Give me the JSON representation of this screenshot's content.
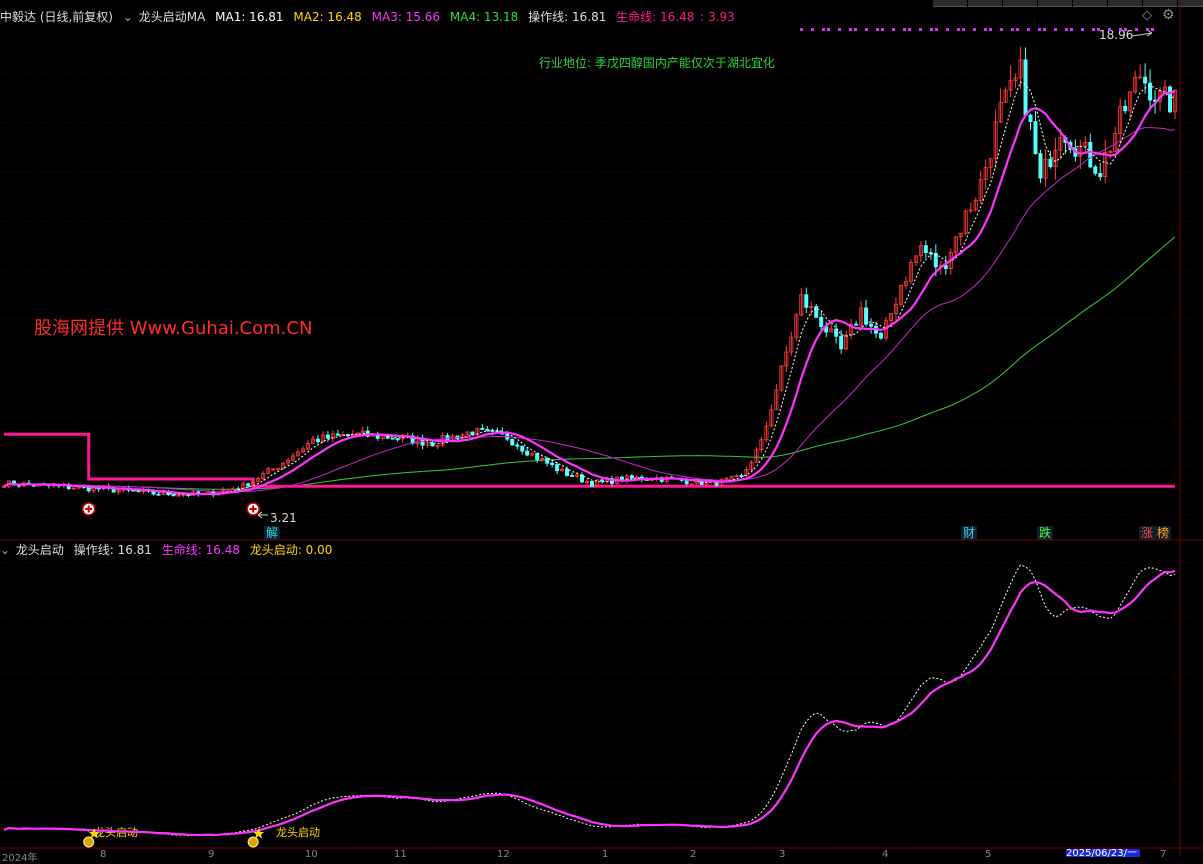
{
  "main_panel": {
    "stock_label": "中毅达 (日线,前复权)",
    "indicator_name": "龙头启动MA",
    "ma1": {
      "label": "MA1: 16.81",
      "color": "#ffffff"
    },
    "ma2": {
      "label": "MA2: 16.48",
      "color": "#ffd700"
    },
    "ma3": {
      "label": "MA3: 15.66",
      "color": "#ff33ff"
    },
    "ma4": {
      "label": "MA4: 13.18",
      "color": "#33dd33"
    },
    "operation_line": "操作线: 16.81",
    "life_line": "生命线: 16.48",
    "ratio": ": 3.93",
    "industry_note": "行业地位: 季戊四醇国内产能仅次于湖北宜化",
    "high_label": "18.96",
    "low_label": "3.21",
    "badges": [
      {
        "text": "解",
        "color": "#22ddee"
      },
      {
        "text": "财",
        "color": "#22ddee"
      },
      {
        "text": "跌",
        "color": "#44ff44"
      },
      {
        "text": "涨",
        "color": "#ff4444"
      },
      {
        "text": "榜",
        "color": "#ffaa00"
      }
    ]
  },
  "watermark": "股海网提供 Www.Guhai.Com.CN",
  "sub_panel": {
    "indicator_name": "龙头启动",
    "operation_line": "操作线: 16.81",
    "life_line": "生命线: 16.48",
    "launch_value": "龙头启动: 0.00",
    "launch_markers": [
      "龙头启动",
      "龙头启动"
    ]
  },
  "date_axis": {
    "labels": [
      "2024年",
      "8",
      "9",
      "10",
      "11",
      "12",
      "1",
      "2",
      "3",
      "4",
      "5",
      "6",
      "7"
    ],
    "current_date": "2025/06/23/一"
  },
  "colors": {
    "up": "#ff3b3b",
    "down": "#54ffff",
    "life_line": "#ff1493",
    "operation_line": "#ff33ff",
    "ma4": "#33cc33",
    "grid": "#3a0000"
  },
  "chart_data": {
    "type": "candlestick",
    "price_range": [
      2.5,
      19.5
    ],
    "anchors": [
      [
        0,
        3.6
      ],
      [
        10,
        3.5
      ],
      [
        20,
        3.4
      ],
      [
        30,
        3.25
      ],
      [
        40,
        3.21
      ],
      [
        48,
        3.5
      ],
      [
        55,
        4.2
      ],
      [
        62,
        5.1
      ],
      [
        70,
        5.3
      ],
      [
        78,
        5.2
      ],
      [
        86,
        5.0
      ],
      [
        94,
        5.4
      ],
      [
        101,
        5.2
      ],
      [
        106,
        4.6
      ],
      [
        112,
        4.0
      ],
      [
        118,
        3.6
      ],
      [
        124,
        3.75
      ],
      [
        130,
        3.8
      ],
      [
        136,
        3.7
      ],
      [
        142,
        3.6
      ],
      [
        148,
        3.8
      ],
      [
        152,
        5.0
      ],
      [
        156,
        7.5
      ],
      [
        160,
        10.0
      ],
      [
        164,
        9.2
      ],
      [
        168,
        8.2
      ],
      [
        172,
        9.6
      ],
      [
        176,
        8.5
      ],
      [
        180,
        10.5
      ],
      [
        184,
        11.8
      ],
      [
        188,
        11.0
      ],
      [
        192,
        12.5
      ],
      [
        196,
        14.0
      ],
      [
        200,
        16.5
      ],
      [
        204,
        17.8
      ],
      [
        208,
        14.0
      ],
      [
        212,
        16.0
      ],
      [
        216,
        15.2
      ],
      [
        220,
        14.5
      ],
      [
        224,
        16.2
      ],
      [
        228,
        17.8
      ],
      [
        232,
        16.9
      ],
      [
        235,
        16.81
      ]
    ],
    "life_line_steps": [
      {
        "from": 0,
        "to": 17,
        "value": 5.3
      },
      {
        "from": 17,
        "to": 50,
        "value": 3.75
      },
      {
        "from": 50,
        "to": 235,
        "value": 3.5
      }
    ]
  }
}
